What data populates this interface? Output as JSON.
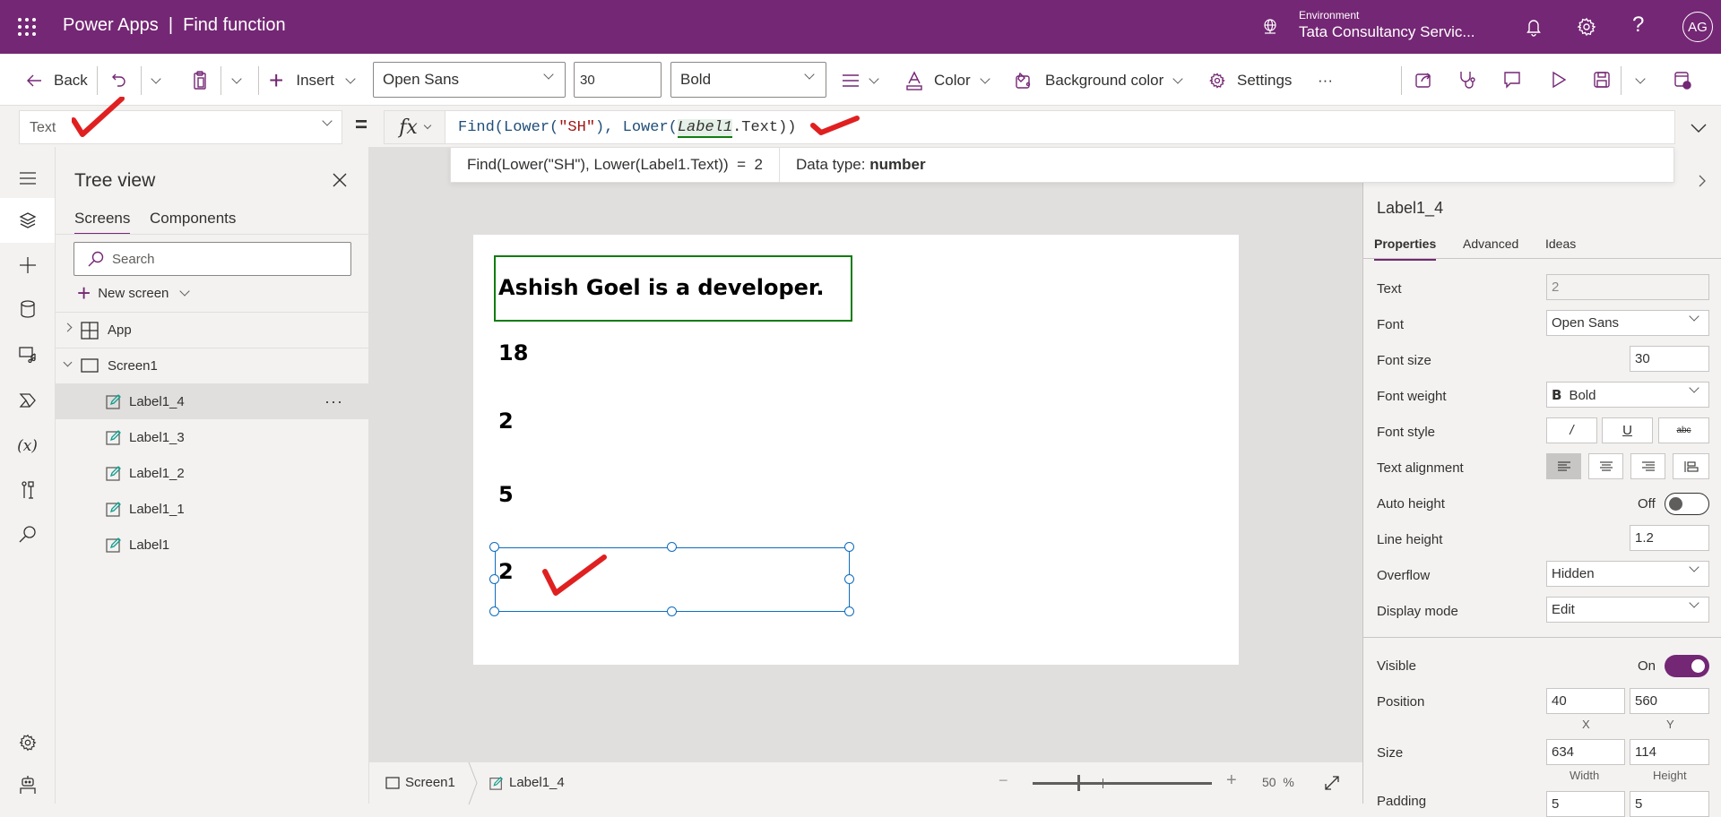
{
  "topbar": {
    "title": "Power Apps  |  Find function",
    "environment_label": "Environment",
    "environment_name": "Tata Consultancy Servic...",
    "avatar_initials": "AG",
    "brand_color": "#742774"
  },
  "toolbar": {
    "back_label": "Back",
    "insert_label": "Insert",
    "font_value": "Open Sans",
    "font_size_value": "30",
    "font_weight_value": "Bold",
    "color_label": "Color",
    "background_color_label": "Background color",
    "settings_label": "Settings",
    "more_label": "···"
  },
  "formula_bar": {
    "property": "Text",
    "equals": "=",
    "fx_label": "fx",
    "formula_parts": {
      "func1": "Find(Lower(",
      "str1": "\"SH\"",
      "mid": "), Lower(",
      "control": "Label1",
      "end": ".Text))"
    },
    "result_expression": "Find(Lower(\"SH\"), Lower(Label1.Text))  =  2",
    "data_type_label": "Data type: ",
    "data_type_value": "number"
  },
  "tree_view": {
    "title": "Tree view",
    "tabs": [
      {
        "label": "Screens",
        "active": true
      },
      {
        "label": "Components",
        "active": false
      }
    ],
    "search_placeholder": "Search",
    "new_screen_label": "New screen",
    "nodes": [
      {
        "label": "App",
        "type": "app"
      },
      {
        "label": "Screen1",
        "type": "screen"
      },
      {
        "label": "Label1_4",
        "type": "label",
        "selected": true
      },
      {
        "label": "Label1_3",
        "type": "label"
      },
      {
        "label": "Label1_2",
        "type": "label"
      },
      {
        "label": "Label1_1",
        "type": "label"
      },
      {
        "label": "Label1",
        "type": "label"
      }
    ],
    "more_label": "···"
  },
  "canvas": {
    "labels": [
      {
        "name": "Label1",
        "text": "Ashish Goel is a developer."
      },
      {
        "name": "Label1_1",
        "text": "18"
      },
      {
        "name": "Label1_2",
        "text": "2"
      },
      {
        "name": "Label1_3",
        "text": "5"
      },
      {
        "name": "Label1_4",
        "text": "2"
      }
    ],
    "annotation_color": "#e02020"
  },
  "status_bar": {
    "screen_crumb": "Screen1",
    "control_crumb": "Label1_4",
    "zoom_minus": "−",
    "zoom_plus": "+",
    "zoom_value": "50",
    "zoom_unit": "%",
    "zoom_percent": 50
  },
  "properties_panel": {
    "control_name": "Label1_4",
    "tabs": [
      {
        "label": "Properties",
        "active": true
      },
      {
        "label": "Advanced",
        "active": false
      },
      {
        "label": "Ideas",
        "active": false
      }
    ],
    "text_label": "Text",
    "text_value": "2",
    "font_label": "Font",
    "font_value": "Open Sans",
    "font_size_label": "Font size",
    "font_size_value": "30",
    "font_weight_label": "Font weight",
    "font_weight_value": "Bold",
    "font_weight_icon": "B",
    "font_style_label": "Font style",
    "font_style_buttons": [
      "/",
      "U",
      "abc"
    ],
    "text_alignment_label": "Text alignment",
    "text_alignment_selected": "left",
    "auto_height_label": "Auto height",
    "auto_height_state": "Off",
    "line_height_label": "Line height",
    "line_height_value": "1.2",
    "overflow_label": "Overflow",
    "overflow_value": "Hidden",
    "display_mode_label": "Display mode",
    "display_mode_value": "Edit",
    "visible_label": "Visible",
    "visible_state": "On",
    "position_label": "Position",
    "position_x": "40",
    "position_y": "560",
    "x_label": "X",
    "y_label": "Y",
    "size_label": "Size",
    "size_width": "634",
    "size_height": "114",
    "width_label": "Width",
    "height_label": "Height",
    "padding_label": "Padding",
    "padding_values": [
      "5",
      "5"
    ]
  }
}
